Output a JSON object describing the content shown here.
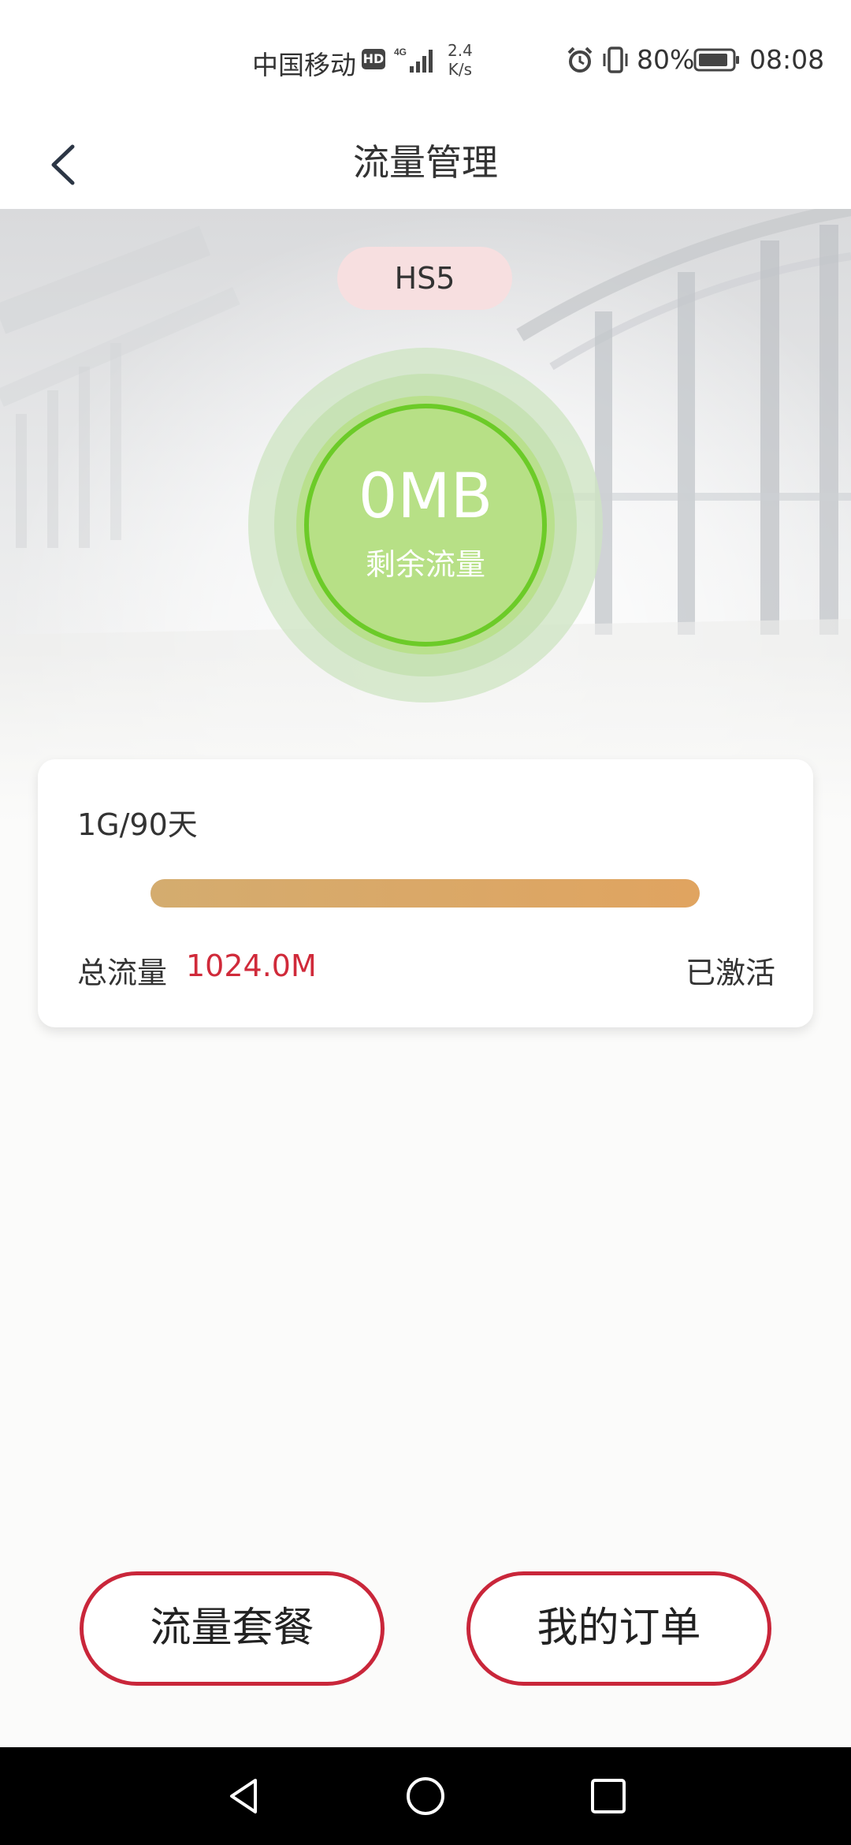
{
  "status_bar": {
    "carrier": "中国移动",
    "hd": "HD",
    "network": "4G",
    "speed_value": "2.4",
    "speed_unit": "K/s",
    "battery": "80%",
    "time": "08:08"
  },
  "header": {
    "title": "流量管理"
  },
  "device": {
    "name": "HS5"
  },
  "remaining": {
    "value": "0MB",
    "label": "剩余流量"
  },
  "plan_card": {
    "plan_name": "1G/90天",
    "usage_fraction": 1.0,
    "total_label": "总流量",
    "total_value": "1024.0M",
    "status": "已激活"
  },
  "buttons": {
    "data_plans": "流量套餐",
    "my_orders": "我的订单"
  },
  "colors": {
    "accent_red": "#c9263a",
    "value_red": "#d02a3a",
    "ring_green": "#6ccb28",
    "progress_gold": "#d4ac6f"
  },
  "icons": [
    "back-chevron-icon",
    "hd-icon",
    "signal-icon",
    "alarm-icon",
    "vibrate-icon",
    "battery-icon",
    "nav-back-icon",
    "nav-home-icon",
    "nav-recents-icon"
  ]
}
